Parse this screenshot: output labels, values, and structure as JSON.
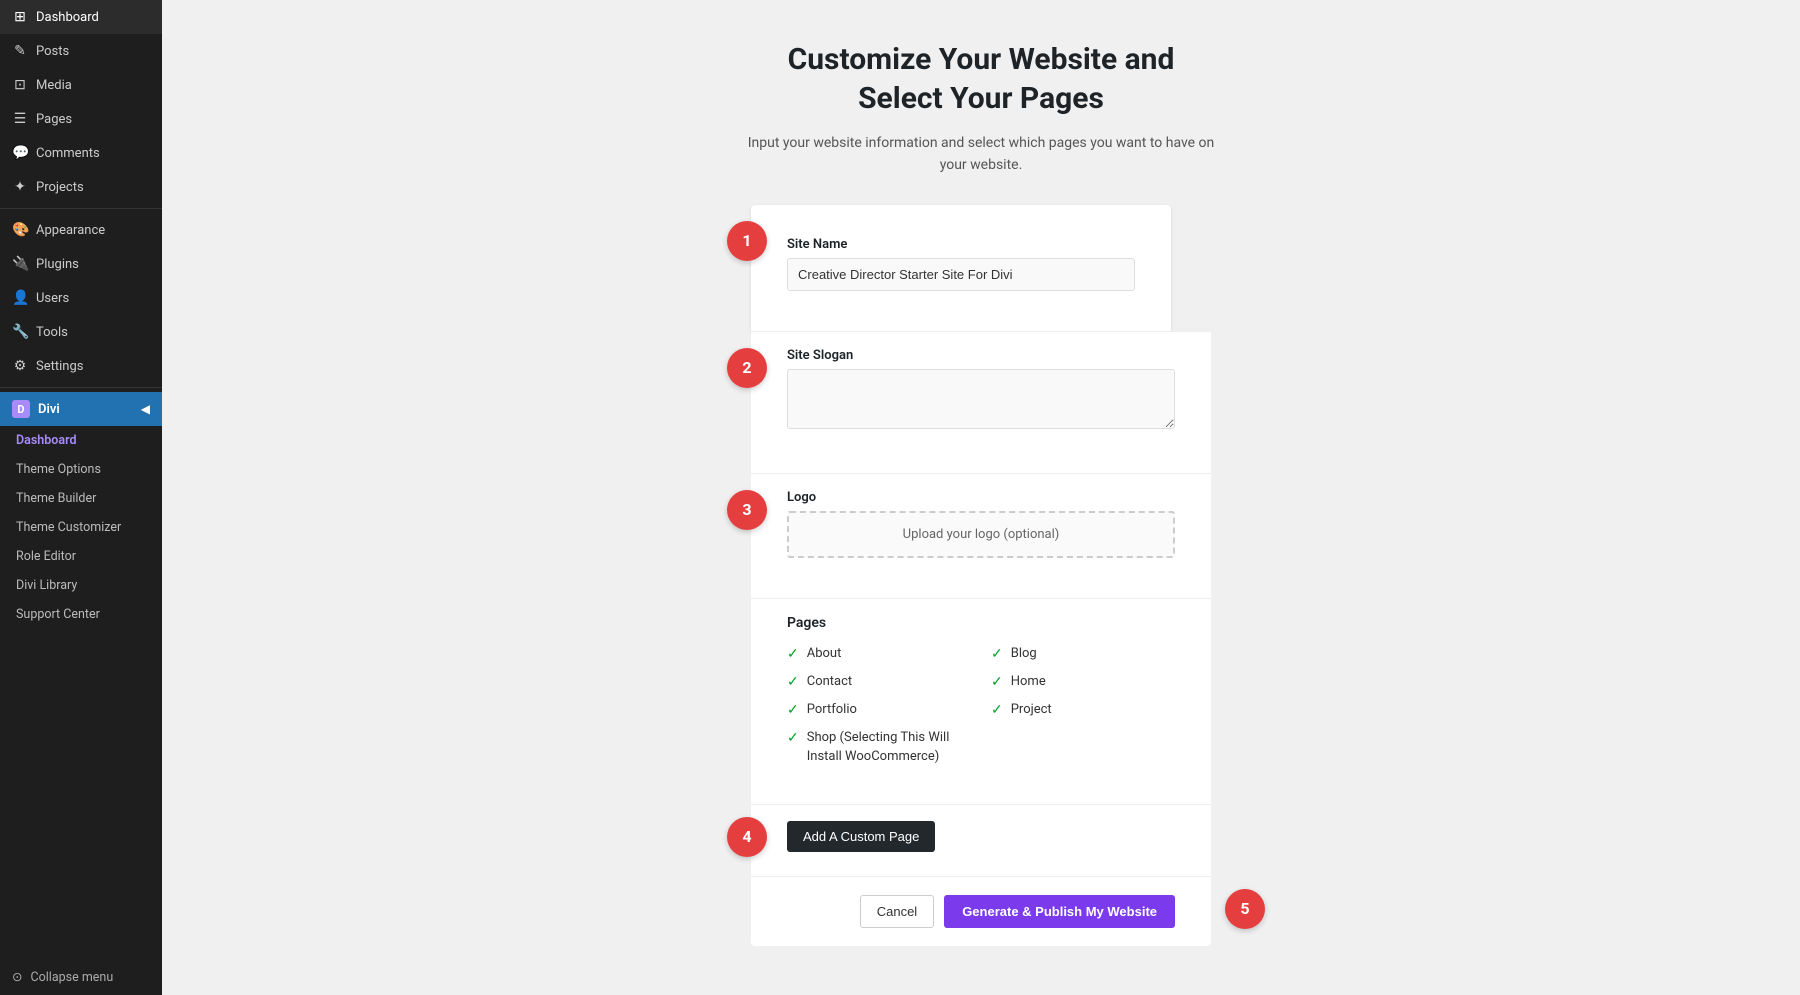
{
  "sidebar": {
    "items": [
      {
        "label": "Dashboard",
        "icon": "⊞",
        "active": false
      },
      {
        "label": "Posts",
        "icon": "✎",
        "active": false
      },
      {
        "label": "Media",
        "icon": "⊡",
        "active": false
      },
      {
        "label": "Pages",
        "icon": "☰",
        "active": false
      },
      {
        "label": "Comments",
        "icon": "💬",
        "active": false
      },
      {
        "label": "Projects",
        "icon": "✦",
        "active": false
      },
      {
        "label": "Appearance",
        "icon": "🎨",
        "active": false
      },
      {
        "label": "Plugins",
        "icon": "🔌",
        "active": false
      },
      {
        "label": "Users",
        "icon": "👤",
        "active": false
      },
      {
        "label": "Tools",
        "icon": "🔧",
        "active": false
      },
      {
        "label": "Settings",
        "icon": "⚙",
        "active": false
      }
    ],
    "divi_label": "Divi",
    "divi_sub_items": [
      {
        "label": "Dashboard",
        "active": true
      },
      {
        "label": "Theme Options",
        "active": false
      },
      {
        "label": "Theme Builder",
        "active": false
      },
      {
        "label": "Theme Customizer",
        "active": false
      },
      {
        "label": "Role Editor",
        "active": false
      },
      {
        "label": "Divi Library",
        "active": false
      },
      {
        "label": "Support Center",
        "active": false
      }
    ],
    "collapse_label": "Collapse menu"
  },
  "main": {
    "title_line1": "Customize Your Website and",
    "title_line2": "Select Your Pages",
    "subtitle": "Input your website information and select which pages you want to have on your website."
  },
  "form": {
    "site_name_label": "Site Name",
    "site_name_value": "Creative Director Starter Site For Divi",
    "site_slogan_label": "Site Slogan",
    "site_slogan_value": "",
    "logo_label": "Logo",
    "logo_placeholder": "Upload your logo (optional)",
    "pages_label": "Pages",
    "pages": [
      {
        "label": "About",
        "checked": true,
        "col": 1
      },
      {
        "label": "Blog",
        "checked": true,
        "col": 2
      },
      {
        "label": "Contact",
        "checked": true,
        "col": 1
      },
      {
        "label": "Home",
        "checked": true,
        "col": 2
      },
      {
        "label": "Portfolio",
        "checked": true,
        "col": 1
      },
      {
        "label": "Project",
        "checked": true,
        "col": 2
      },
      {
        "label": "Shop (Selecting This Will Install WooCommerce)",
        "checked": true,
        "col": 1
      }
    ],
    "add_custom_label": "Add A Custom Page",
    "cancel_label": "Cancel",
    "publish_label": "Generate & Publish My Website"
  },
  "steps": [
    {
      "number": "1"
    },
    {
      "number": "2"
    },
    {
      "number": "3"
    },
    {
      "number": "4"
    },
    {
      "number": "5"
    }
  ]
}
